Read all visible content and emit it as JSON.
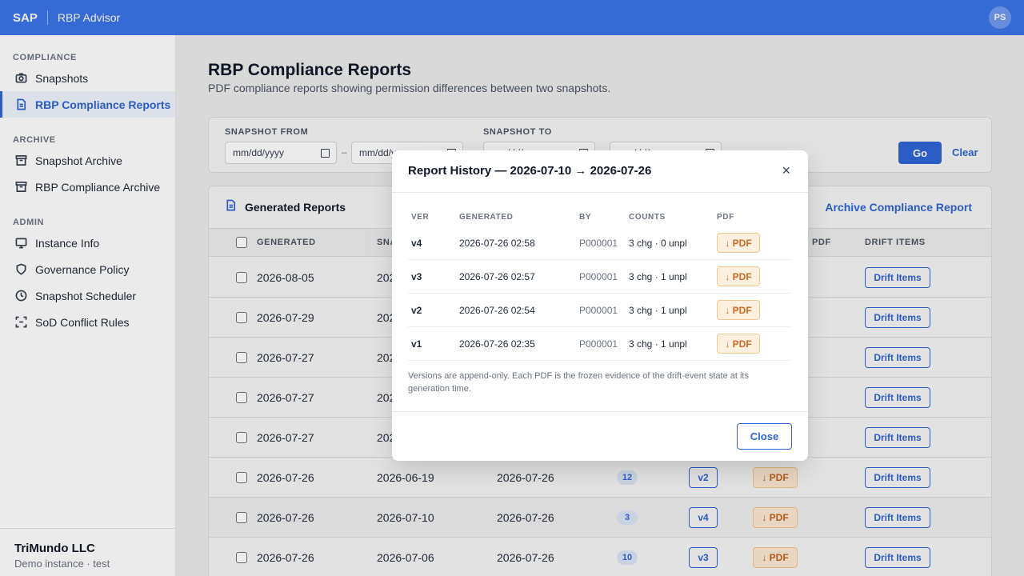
{
  "topbar": {
    "brand": "SAP",
    "app_name": "RBP Advisor",
    "avatar": "PS"
  },
  "sidebar": {
    "sections": [
      {
        "label": "COMPLIANCE",
        "items": [
          {
            "label": "Snapshots",
            "icon": "camera-icon",
            "active": false
          },
          {
            "label": "RBP Compliance Reports",
            "icon": "document-icon",
            "active": true
          }
        ]
      },
      {
        "label": "ARCHIVE",
        "items": [
          {
            "label": "Snapshot Archive",
            "icon": "archive-box-icon",
            "active": false
          },
          {
            "label": "RBP Compliance Archive",
            "icon": "archive-box-icon",
            "active": false
          }
        ]
      },
      {
        "label": "ADMIN",
        "items": [
          {
            "label": "Instance Info",
            "icon": "monitor-icon",
            "active": false
          },
          {
            "label": "Governance Policy",
            "icon": "shield-icon",
            "active": false
          },
          {
            "label": "Snapshot Scheduler",
            "icon": "clock-icon",
            "active": false
          },
          {
            "label": "SoD Conflict Rules",
            "icon": "scan-frame-icon",
            "active": false
          }
        ]
      }
    ],
    "footer": {
      "org": "TriMundo LLC",
      "sub": "Demo instance · test"
    }
  },
  "page": {
    "title": "RBP Compliance Reports",
    "subtitle": "PDF compliance reports showing permission differences between two snapshots."
  },
  "filters": {
    "from_label": "SNAPSHOT FROM",
    "to_label": "SNAPSHOT TO",
    "date_placeholder": "mm/dd/yyyy",
    "dash": "–",
    "go": "Go",
    "clear": "Clear"
  },
  "reports": {
    "title": "Generated Reports",
    "archive_link": "Archive Compliance Report",
    "columns": {
      "generated": "GENERATED",
      "snapshot": "SNA",
      "pdf": "PDF",
      "drift": "DRIFT ITEMS"
    },
    "drift_label": "Drift Items",
    "pdf_label": "↓ PDF",
    "rows": [
      {
        "generated": "2026-08-05",
        "snap_from": "202",
        "snap_to": "",
        "count": "",
        "ver": ""
      },
      {
        "generated": "2026-07-29",
        "snap_from": "202",
        "snap_to": "",
        "count": "",
        "ver": ""
      },
      {
        "generated": "2026-07-27",
        "snap_from": "202",
        "snap_to": "",
        "count": "",
        "ver": ""
      },
      {
        "generated": "2026-07-27",
        "snap_from": "202",
        "snap_to": "",
        "count": "",
        "ver": ""
      },
      {
        "generated": "2026-07-27",
        "snap_from": "202",
        "snap_to": "",
        "count": "",
        "ver": ""
      },
      {
        "generated": "2026-07-26",
        "snap_from": "2026-06-19",
        "snap_to": "2026-07-26",
        "count": "12",
        "ver": "v2"
      },
      {
        "generated": "2026-07-26",
        "snap_from": "2026-07-10",
        "snap_to": "2026-07-26",
        "count": "3",
        "ver": "v4"
      },
      {
        "generated": "2026-07-26",
        "snap_from": "2026-07-06",
        "snap_to": "2026-07-26",
        "count": "10",
        "ver": "v3"
      }
    ]
  },
  "modal": {
    "title": "Report History — 2026-07-10 → 2026-07-26",
    "close_x": "×",
    "columns": {
      "ver": "VER",
      "generated": "GENERATED",
      "by": "BY",
      "counts": "COUNTS",
      "pdf": "PDF"
    },
    "pdf_label": "↓ PDF",
    "rows": [
      {
        "ver": "v4",
        "generated": "2026-07-26 02:58",
        "by": "P000001",
        "counts": "3 chg · 0 unpl"
      },
      {
        "ver": "v3",
        "generated": "2026-07-26 02:57",
        "by": "P000001",
        "counts": "3 chg · 1 unpl"
      },
      {
        "ver": "v2",
        "generated": "2026-07-26 02:54",
        "by": "P000001",
        "counts": "3 chg · 1 unpl"
      },
      {
        "ver": "v1",
        "generated": "2026-07-26 02:35",
        "by": "P000001",
        "counts": "3 chg · 1 unpl"
      }
    ],
    "note": "Versions are append-only. Each PDF is the frozen evidence of the drift-event state at its generation time.",
    "close_button": "Close"
  }
}
